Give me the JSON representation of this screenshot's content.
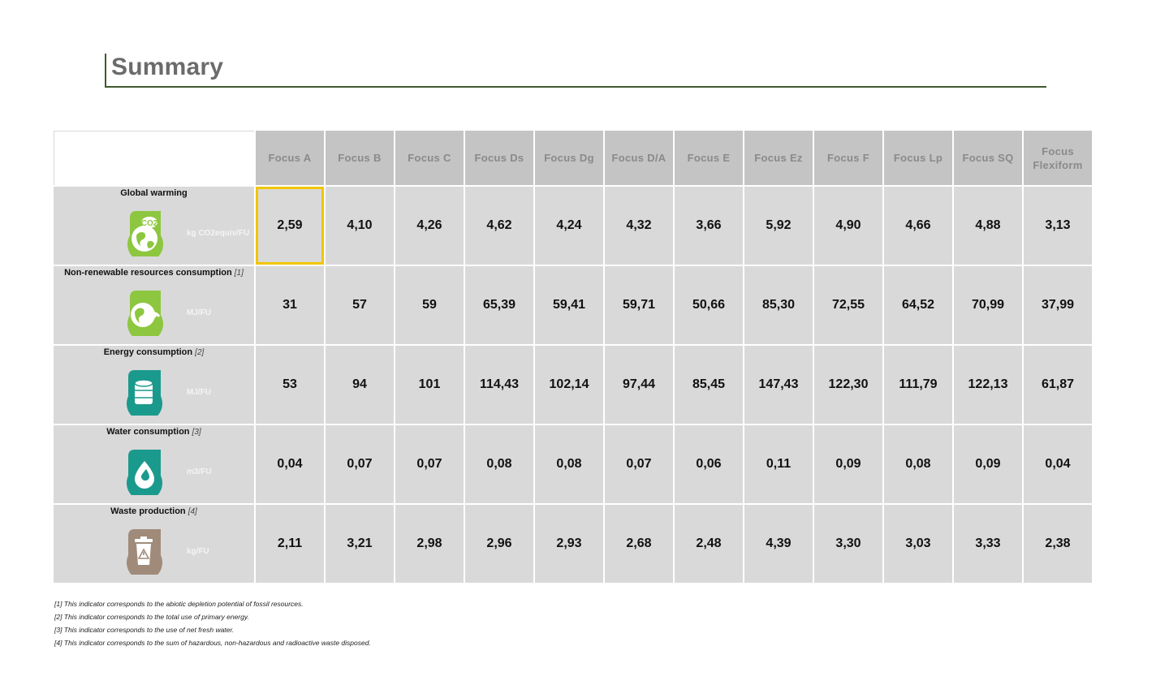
{
  "title": "Summary",
  "columns": [
    "Focus A",
    "Focus B",
    "Focus C",
    "Focus Ds",
    "Focus Dg",
    "Focus D/A",
    "Focus E",
    "Focus Ez",
    "Focus F",
    "Focus Lp",
    "Focus SQ",
    "Focus Flexiform"
  ],
  "rows": [
    {
      "label": "Global warming",
      "note": "",
      "unit": "kg CO2equiv/FU",
      "icon": "co2-globe-icon",
      "values": [
        "2,59",
        "4,10",
        "4,26",
        "4,62",
        "4,24",
        "4,32",
        "3,66",
        "5,92",
        "4,90",
        "4,66",
        "4,88",
        "3,13"
      ]
    },
    {
      "label": "Non-renewable resources consumption",
      "note": "[1]",
      "unit": "MJ/FU",
      "icon": "globe-pickaxe-icon",
      "values": [
        "31",
        "57",
        "59",
        "65,39",
        "59,41",
        "59,71",
        "50,66",
        "85,30",
        "72,55",
        "64,52",
        "70,99",
        "37,99"
      ]
    },
    {
      "label": "Energy consumption",
      "note": "[2]",
      "unit": "MJ/FU",
      "icon": "oil-barrel-icon",
      "values": [
        "53",
        "94",
        "101",
        "114,43",
        "102,14",
        "97,44",
        "85,45",
        "147,43",
        "122,30",
        "111,79",
        "122,13",
        "61,87"
      ]
    },
    {
      "label": "Water consumption",
      "note": "[3]",
      "unit": "m3/FU",
      "icon": "water-drop-icon",
      "values": [
        "0,04",
        "0,07",
        "0,07",
        "0,08",
        "0,08",
        "0,07",
        "0,06",
        "0,11",
        "0,09",
        "0,08",
        "0,09",
        "0,04"
      ]
    },
    {
      "label": "Waste production",
      "note": "[4]",
      "unit": "kg/FU",
      "icon": "waste-bin-icon",
      "values": [
        "2,11",
        "3,21",
        "2,98",
        "2,96",
        "2,93",
        "2,68",
        "2,48",
        "4,39",
        "3,30",
        "3,03",
        "3,33",
        "2,38"
      ]
    }
  ],
  "footnotes": [
    "[1] This indicator corresponds to the abiotic depletion potential of fossil resources.",
    "[2] This indicator corresponds to the total use of primary energy.",
    "[3] This indicator corresponds to the use of net fresh water.",
    "[4] This indicator corresponds to the sum of hazardous, non-hazardous and radioactive waste disposed."
  ],
  "colors": {
    "green": "#8dc63f",
    "teal": "#1a9a8c",
    "brown": "#a08b7a",
    "highlight": "#f2c500",
    "title_rule": "#3f5a2e"
  }
}
